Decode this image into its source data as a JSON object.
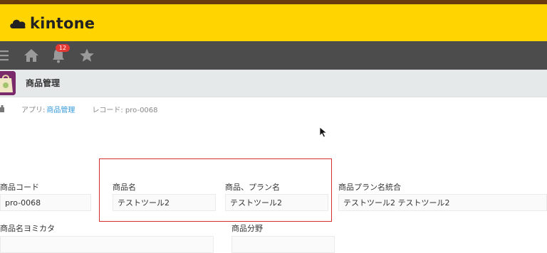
{
  "header": {
    "logo_text": "kintone",
    "brand_color": "#ffd400"
  },
  "nav": {
    "icons": [
      "menu-icon",
      "home-icon",
      "bell-icon",
      "star-icon"
    ],
    "notification_count": "12"
  },
  "app": {
    "title": "商品管理"
  },
  "breadcrumb": {
    "app_label": "アプリ:",
    "app_link": "商品管理",
    "record_label": "レコード: pro-0068"
  },
  "fields": {
    "product_code": {
      "label": "商品コード",
      "value": "pro-0068"
    },
    "product_name": {
      "label": "商品名",
      "value": "テストツール2"
    },
    "product_plan_name": {
      "label": "商品、プラン名",
      "value": "テストツール2"
    },
    "plan_name_combined": {
      "label": "商品プラン名統合",
      "value": "テストツール2 テストツール2"
    },
    "product_name_kana": {
      "label": "商品名ヨミカタ"
    },
    "product_category": {
      "label": "商品分野"
    }
  },
  "highlight_color": "#d32f2f"
}
